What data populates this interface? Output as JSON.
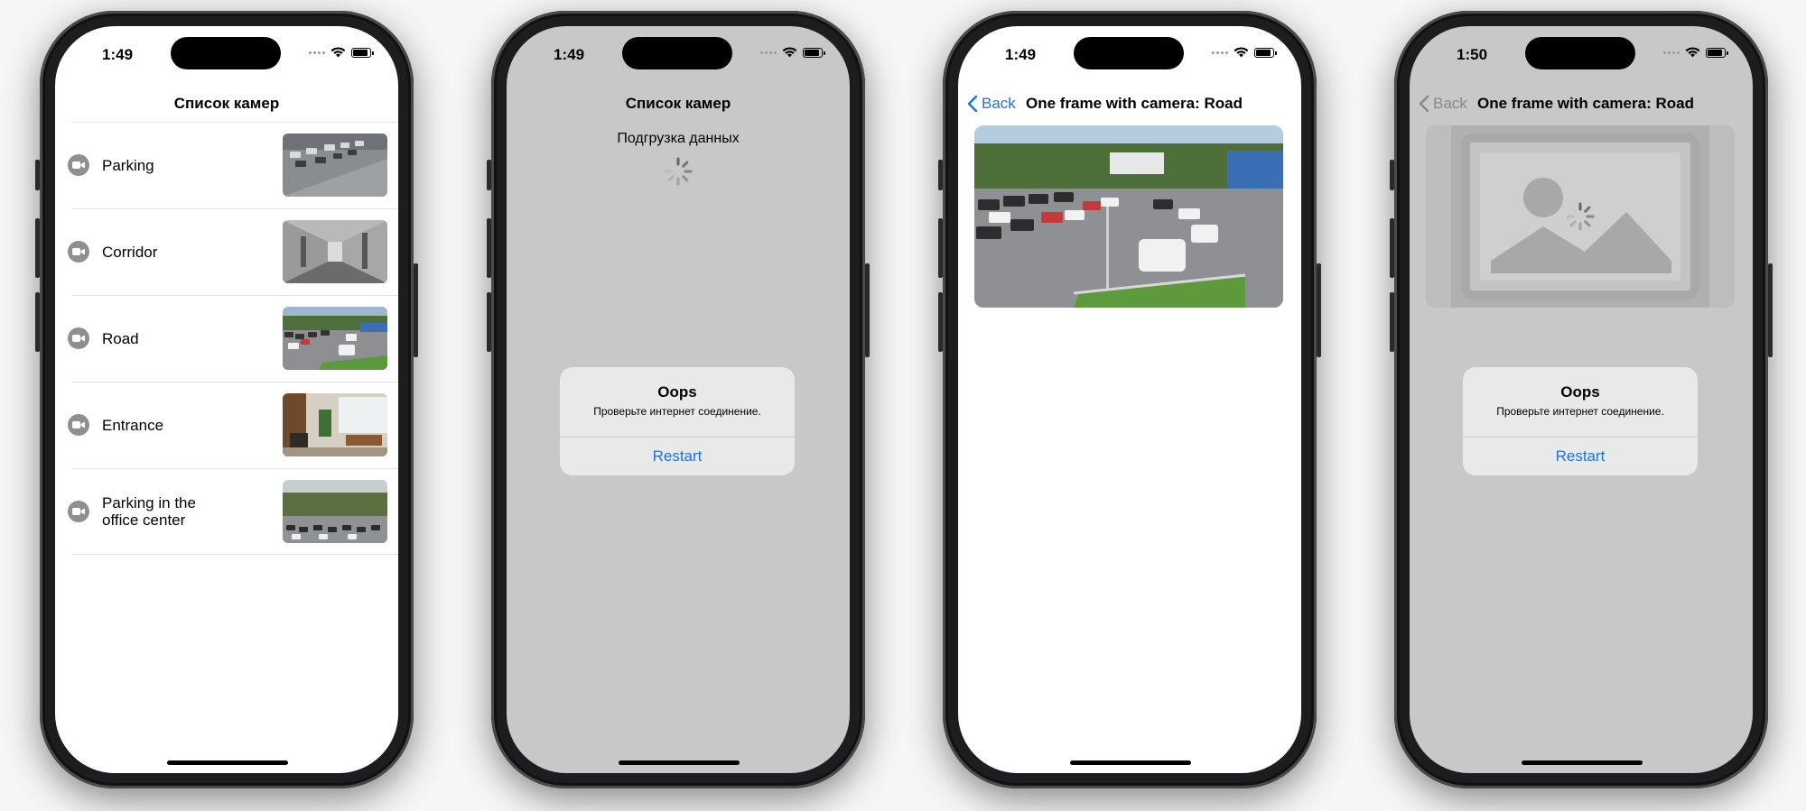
{
  "screens": [
    {
      "status_time": "1:49",
      "title": "Список камер",
      "cameras": [
        {
          "name": "Parking"
        },
        {
          "name": "Corridor"
        },
        {
          "name": "Road"
        },
        {
          "name": "Entrance"
        },
        {
          "name": "Parking in the\noffice center"
        }
      ]
    },
    {
      "status_time": "1:49",
      "title": "Список камер",
      "loading_text": "Подгрузка данных",
      "alert": {
        "title": "Oops",
        "message": "Проверьте интернет соединение.",
        "button": "Restart"
      }
    },
    {
      "status_time": "1:49",
      "back_label": "Back",
      "title": "One frame with camera: Road"
    },
    {
      "status_time": "1:50",
      "back_label": "Back",
      "title": "One frame with camera: Road",
      "alert": {
        "title": "Oops",
        "message": "Проверьте интернет соединение.",
        "button": "Restart"
      }
    }
  ],
  "colors": {
    "accent": "#1a73e8",
    "dim_overlay": "#c8c8c8",
    "icon_gray": "#8e8e93"
  }
}
